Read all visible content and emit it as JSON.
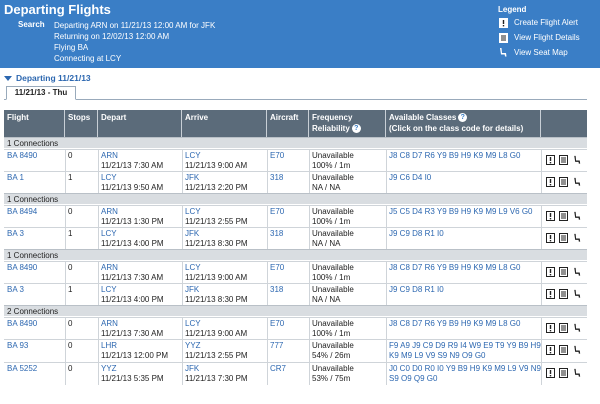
{
  "header": {
    "title": "Departing Flights",
    "search_label": "Search",
    "search_lines": [
      "Departing ARN on 11/21/13 12:00 AM for JFK",
      "Returning on 12/02/13 12:00 AM",
      "Flying BA",
      "Connecting at LCY"
    ]
  },
  "legend": {
    "title": "Legend",
    "items": [
      {
        "icon": "alert-icon",
        "label": "Create Flight Alert"
      },
      {
        "icon": "details-icon",
        "label": "View Flight Details"
      },
      {
        "icon": "seat-icon",
        "label": "View Seat Map"
      }
    ]
  },
  "departing": {
    "label": "Departing 11/21/13",
    "tab": "11/21/13 - Thu"
  },
  "table": {
    "headers": {
      "flight": "Flight",
      "stops": "Stops",
      "depart": "Depart",
      "arrive": "Arrive",
      "aircraft": "Aircraft",
      "frequency": "Frequency",
      "reliability": "Reliability",
      "classes": "Available Classes",
      "classes_sub": "(Click on the class code for details)"
    },
    "groups": [
      {
        "connections": "1 Connections",
        "flights": [
          {
            "flight": "BA 8490",
            "stops": "0",
            "from": "ARN",
            "dep": "11/21/13 7:30 AM",
            "to": "LCY",
            "arr": "11/21/13 9:00 AM",
            "aircraft": "E70",
            "freq": "Unavailable",
            "rel": "100% / 1m",
            "classes": [
              "J8 C8 D7 R6 Y9 B9 H9 K9 M9 L8 G0"
            ]
          },
          {
            "flight": "BA 1",
            "stops": "1",
            "from": "LCY",
            "dep": "11/21/13 9:50 AM",
            "to": "JFK",
            "arr": "11/21/13 2:20 PM",
            "aircraft": "318",
            "freq": "Unavailable",
            "rel": "NA / NA",
            "classes": [
              "J9 C6 D4 I0"
            ]
          }
        ]
      },
      {
        "connections": "1 Connections",
        "flights": [
          {
            "flight": "BA 8494",
            "stops": "0",
            "from": "ARN",
            "dep": "11/21/13 1:30 PM",
            "to": "LCY",
            "arr": "11/21/13 2:55 PM",
            "aircraft": "E70",
            "freq": "Unavailable",
            "rel": "100% / 1m",
            "classes": [
              "J5 C5 D4 R3 Y9 B9 H9 K9 M9 L9 V6 G0"
            ]
          },
          {
            "flight": "BA 3",
            "stops": "1",
            "from": "LCY",
            "dep": "11/21/13 4:00 PM",
            "to": "JFK",
            "arr": "11/21/13 8:30 PM",
            "aircraft": "318",
            "freq": "Unavailable",
            "rel": "NA / NA",
            "classes": [
              "J9 C9 D8 R1 I0"
            ]
          }
        ]
      },
      {
        "connections": "1 Connections",
        "flights": [
          {
            "flight": "BA 8490",
            "stops": "0",
            "from": "ARN",
            "dep": "11/21/13 7:30 AM",
            "to": "LCY",
            "arr": "11/21/13 9:00 AM",
            "aircraft": "E70",
            "freq": "Unavailable",
            "rel": "100% / 1m",
            "classes": [
              "J8 C8 D7 R6 Y9 B9 H9 K9 M9 L8 G0"
            ]
          },
          {
            "flight": "BA 3",
            "stops": "1",
            "from": "LCY",
            "dep": "11/21/13 4:00 PM",
            "to": "JFK",
            "arr": "11/21/13 8:30 PM",
            "aircraft": "318",
            "freq": "Unavailable",
            "rel": "NA / NA",
            "classes": [
              "J9 C9 D8 R1 I0"
            ]
          }
        ]
      },
      {
        "connections": "2 Connections",
        "flights": [
          {
            "flight": "BA 8490",
            "stops": "0",
            "from": "ARN",
            "dep": "11/21/13 7:30 AM",
            "to": "LCY",
            "arr": "11/21/13 9:00 AM",
            "aircraft": "E70",
            "freq": "Unavailable",
            "rel": "100% / 1m",
            "classes": [
              "J8 C8 D7 R6 Y9 B9 H9 K9 M9 L8 G0"
            ]
          },
          {
            "flight": "BA 93",
            "stops": "0",
            "from": "LHR",
            "dep": "11/21/13 12:00 PM",
            "to": "YYZ",
            "arr": "11/21/13 2:55 PM",
            "aircraft": "777",
            "freq": "Unavailable",
            "rel": "54% / 26m",
            "classes": [
              "F9 A9 J9 C9 D9 R9 I4 W9 E9 T9 Y9 B9 H9",
              "K9 M9 L9 V9 S9 N9 O9 G0"
            ]
          },
          {
            "flight": "BA 5252",
            "stops": "0",
            "from": "YYZ",
            "dep": "11/21/13 5:35 PM",
            "to": "JFK",
            "arr": "11/21/13 7:30 PM",
            "aircraft": "CR7",
            "freq": "Unavailable",
            "rel": "53% / 75m",
            "classes": [
              "J0 C0 D0 R0 I0 Y9 B9 H9 K9 M9 L9 V9 N9",
              "S9 O9 Q9 G0"
            ]
          }
        ]
      }
    ]
  },
  "colors": {
    "header_bg": "#3a7ec6",
    "table_header_bg": "#5b6b7a",
    "link": "#2c67b0",
    "connection_bg": "#d9dde1"
  }
}
